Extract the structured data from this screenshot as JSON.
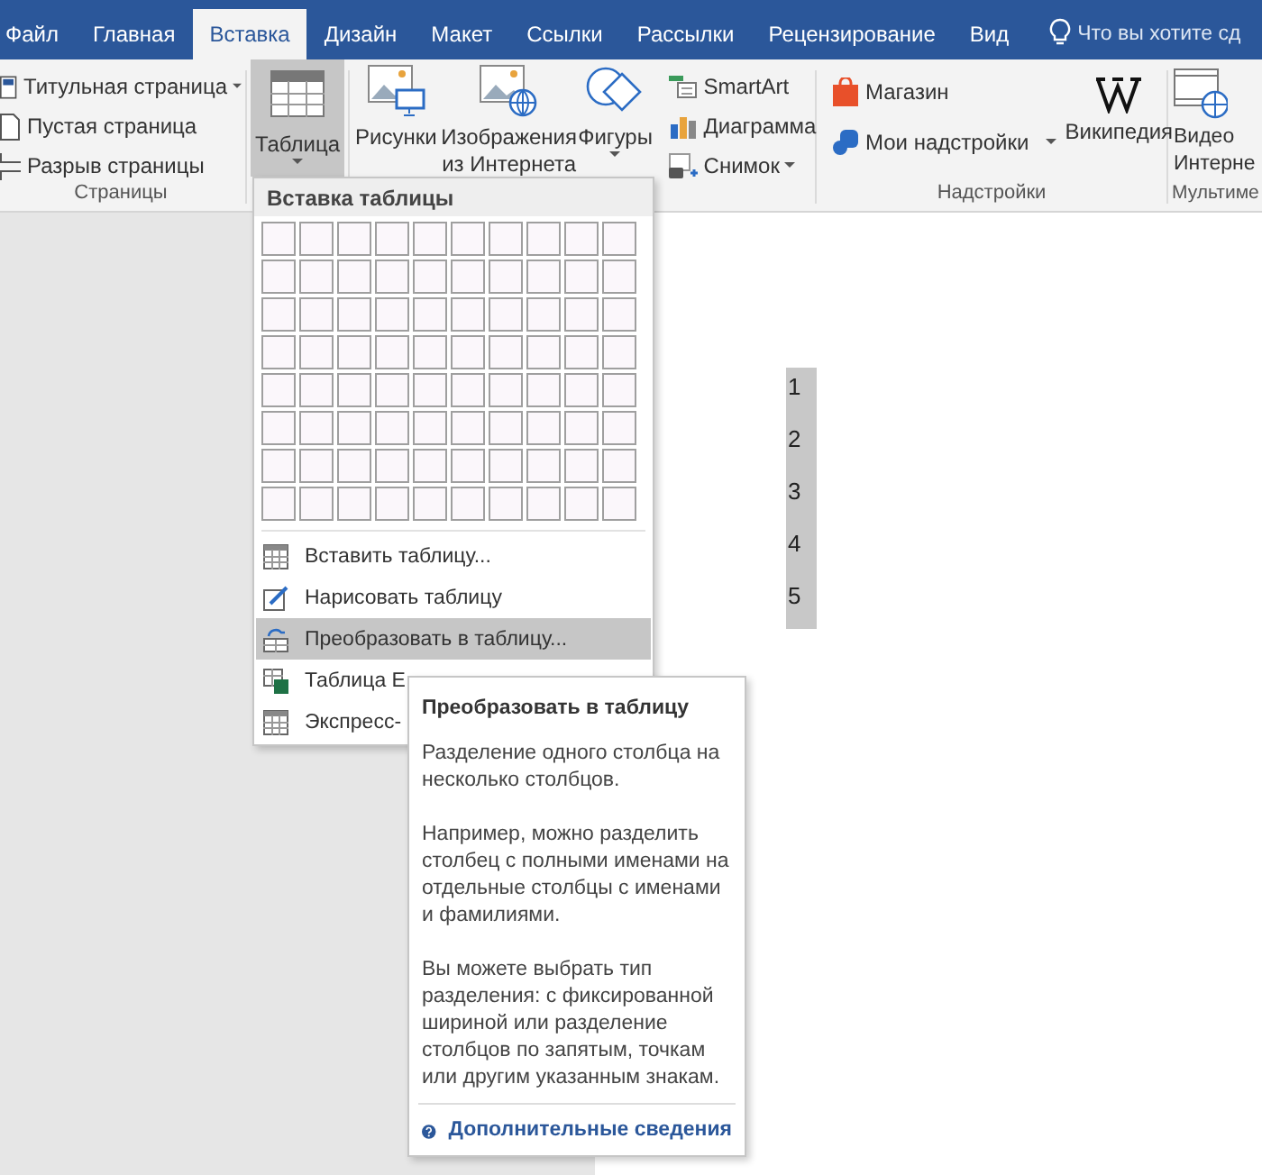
{
  "tabs": [
    {
      "label": "Файл",
      "selected": false
    },
    {
      "label": "Главная",
      "selected": false
    },
    {
      "label": "Вставка",
      "selected": true
    },
    {
      "label": "Дизайн",
      "selected": false
    },
    {
      "label": "Макет",
      "selected": false
    },
    {
      "label": "Ссылки",
      "selected": false
    },
    {
      "label": "Рассылки",
      "selected": false
    },
    {
      "label": "Рецензирование",
      "selected": false
    },
    {
      "label": "Вид",
      "selected": false
    }
  ],
  "tell_me": "Что вы хотите сд",
  "pages_group": {
    "label": "Страницы",
    "commands": [
      {
        "label": "Титульная страница",
        "dropdown": true
      },
      {
        "label": "Пустая страница",
        "dropdown": false
      },
      {
        "label": "Разрыв страницы",
        "dropdown": false
      }
    ]
  },
  "table_button": {
    "label": "Таблица",
    "pressed": true
  },
  "illustrations": {
    "large": [
      {
        "lines": [
          "Рисунки"
        ],
        "dropdown": false
      },
      {
        "lines": [
          "Изображения",
          "из Интернета"
        ],
        "dropdown": false
      },
      {
        "lines": [
          "Фигуры"
        ],
        "dropdown": true
      }
    ],
    "small": [
      {
        "label": "SmartArt",
        "dropdown": false
      },
      {
        "label": "Диаграмма",
        "dropdown": false
      },
      {
        "label": "Снимок",
        "dropdown": true
      }
    ]
  },
  "addins_group": {
    "label": "Надстройки",
    "store": "Магазин",
    "my_addins": "Мои надстройки",
    "wikipedia": "Википедия"
  },
  "media_group": {
    "label": "Мультиме",
    "video_lines": [
      "Видео",
      "Интерне"
    ]
  },
  "table_menu": {
    "title": "Вставка таблицы",
    "items": [
      {
        "label": "Вставить таблицу...",
        "selected": false
      },
      {
        "label": "Нарисовать таблицу",
        "selected": false
      },
      {
        "label": "Преобразовать в таблицу...",
        "selected": true
      },
      {
        "label": "Таблица E",
        "selected": false
      },
      {
        "label": "Экспресс-",
        "selected": false
      }
    ]
  },
  "tooltip": {
    "title": "Преобразовать в таблицу",
    "paragraphs": [
      "Разделение одного столбца на несколько столбцов.",
      "Например, можно разделить столбец с полными именами на отдельные столбцы с именами и фамилиями.",
      "Вы можете выбрать тип разделения: с фиксированной шириной или разделение столбцов по запятым, точкам или другим указанным знакам."
    ],
    "link": "Дополнительные сведения"
  },
  "document": {
    "selected": true,
    "lines": [
      "1",
      "2",
      "3",
      "4",
      "5"
    ]
  }
}
